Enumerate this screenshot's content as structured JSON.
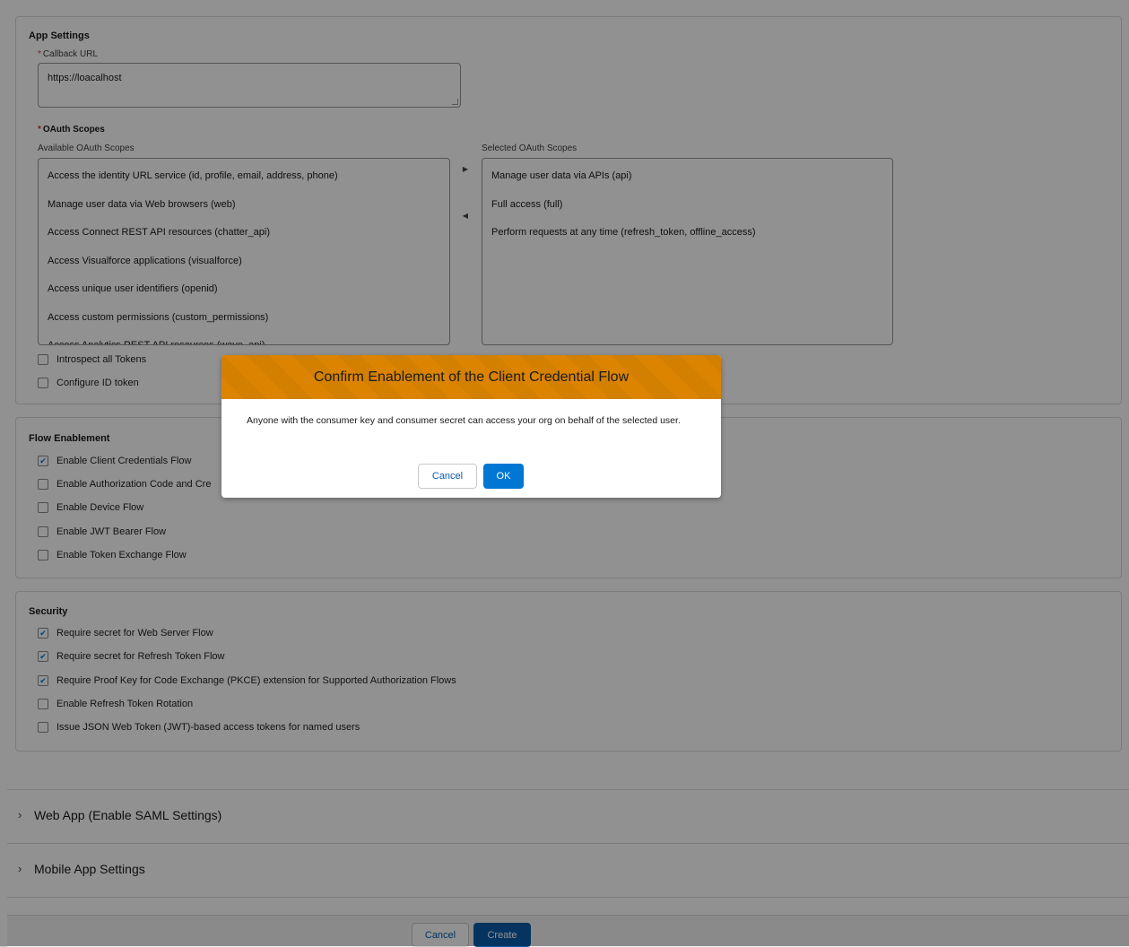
{
  "app_settings": {
    "title": "App Settings",
    "callback_url_label": "Callback URL",
    "callback_url_value": "https://loacalhost",
    "oauth_scopes_label": "OAuth Scopes",
    "available_label": "Available OAuth Scopes",
    "selected_label": "Selected OAuth Scopes",
    "available_scopes": [
      "Access the identity URL service (id, profile, email, address, phone)",
      "Manage user data via Web browsers (web)",
      "Access Connect REST API resources (chatter_api)",
      "Access Visualforce applications (visualforce)",
      "Access unique user identifiers (openid)",
      "Access custom permissions (custom_permissions)",
      "Access Analytics REST API resources (wave_api)"
    ],
    "selected_scopes": [
      "Manage user data via APIs (api)",
      "Full access (full)",
      "Perform requests at any time (refresh_token, offline_access)"
    ],
    "checkboxes": [
      {
        "label": "Introspect all Tokens",
        "checked": false
      },
      {
        "label": "Configure ID token",
        "checked": false
      }
    ]
  },
  "flow_enablement": {
    "title": "Flow Enablement",
    "checkboxes": [
      {
        "label": "Enable Client Credentials Flow",
        "checked": true
      },
      {
        "label": "Enable Authorization Code and Cre",
        "checked": false
      },
      {
        "label": "Enable Device Flow",
        "checked": false
      },
      {
        "label": "Enable JWT Bearer Flow",
        "checked": false
      },
      {
        "label": "Enable Token Exchange Flow",
        "checked": false
      }
    ]
  },
  "security": {
    "title": "Security",
    "checkboxes": [
      {
        "label": "Require secret for Web Server Flow",
        "checked": true
      },
      {
        "label": "Require secret for Refresh Token Flow",
        "checked": true
      },
      {
        "label": "Require Proof Key for Code Exchange (PKCE) extension for Supported Authorization Flows",
        "checked": true
      },
      {
        "label": "Enable Refresh Token Rotation",
        "checked": false
      },
      {
        "label": "Issue JSON Web Token (JWT)-based access tokens for named users",
        "checked": false
      }
    ]
  },
  "sections": [
    {
      "label": "Web App (Enable SAML Settings)"
    },
    {
      "label": "Mobile App Settings"
    }
  ],
  "footer": {
    "cancel_label": "Cancel",
    "create_label": "Create"
  },
  "modal": {
    "title": "Confirm Enablement of the Client Credential Flow",
    "body": "Anyone with the consumer key and consumer secret can access your org on behalf of the selected user.",
    "cancel_label": "Cancel",
    "ok_label": "OK"
  },
  "colors": {
    "brand": "#0b5cab",
    "warning_header": "#dc8400",
    "checkmark": "#0176d3"
  },
  "icons": {
    "move_right": "triangle-right-icon",
    "move_left": "triangle-left-icon",
    "accordion": "chevron-right-icon"
  }
}
